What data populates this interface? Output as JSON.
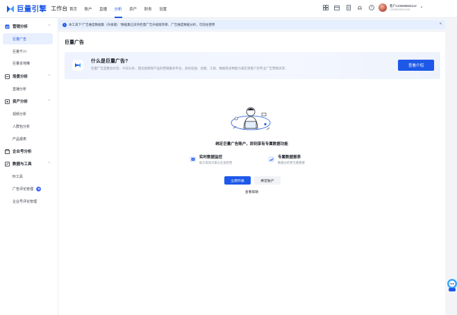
{
  "topbar": {
    "brand": "巨量引擎",
    "workspace": "工作台",
    "nav": [
      {
        "label": "首页",
        "active": false
      },
      {
        "label": "账户",
        "active": false
      },
      {
        "label": "直播",
        "active": false
      },
      {
        "label": "分析",
        "active": true
      },
      {
        "label": "资产",
        "active": false
      },
      {
        "label": "财务",
        "active": false
      },
      {
        "label": "设置",
        "active": false
      }
    ],
    "icons": [
      "grid-icon",
      "calendar-icon",
      "document-icon",
      "bell-icon",
      "help-icon"
    ],
    "user": {
      "name": "客户123838684112",
      "id": "123456789012345",
      "caret": "▾"
    }
  },
  "sidebar": {
    "groups": [
      {
        "label": "营销分析",
        "collapse": "^",
        "icon": "chart-icon"
      },
      {
        "label": "场景分析",
        "collapse": "^",
        "icon": "layers-icon"
      },
      {
        "label": "资产分析",
        "collapse": "^",
        "icon": "box-icon"
      },
      {
        "label": "企业号分析",
        "collapse": "",
        "icon": "store-icon"
      },
      {
        "label": "数据与工具",
        "collapse": "^",
        "icon": "tools-icon"
      }
    ],
    "items": [
      {
        "label": "巨量广告",
        "active": true
      },
      {
        "label": "巨量千川",
        "active": false
      },
      {
        "label": "巨量本地推",
        "active": false
      },
      {
        "label": "直播分析",
        "active": false
      },
      {
        "label": "视频分析",
        "active": false
      },
      {
        "label": "人群包分析",
        "active": false
      },
      {
        "label": "产品报表",
        "active": false
      },
      {
        "label": "BI工具",
        "active": false
      },
      {
        "label": "广告评论管理",
        "active": false
      },
      {
        "label": "企业号评论管理",
        "active": false
      }
    ]
  },
  "notice": {
    "text": "本工具下\"广告维度数据集（升级版）\"数据集已支持巨量广告升级版项目、广告维度数据分析，可前往使用",
    "close": "×"
  },
  "main": {
    "page_title": "巨量广告",
    "intro": {
      "title": "什么是巨量广告?",
      "desc": "巨量广告是整合抖音、今日头条、西瓜视频等产品的营销服务平台，具有投放、创意、工具、数据等多种能力来实现客户的专业广告营销诉求。",
      "button": "查看介绍"
    },
    "bind_title": "绑定巨量广告账户，即刻享有专属数据功能",
    "features": [
      {
        "title": "实时数据监控",
        "desc": "助力高效决策与在投经营",
        "icon": "monitor-icon"
      },
      {
        "title": "专属数据报表",
        "desc": "数据分析更无缝便捷",
        "icon": "report-icon"
      }
    ],
    "primary_button": "立即开通",
    "secondary_button": "绑定账户",
    "help_link": "查看帮助"
  },
  "colors": {
    "accent": "#1d58e8",
    "notice_bg": "#e6efff",
    "active_bg": "#e8efff"
  }
}
